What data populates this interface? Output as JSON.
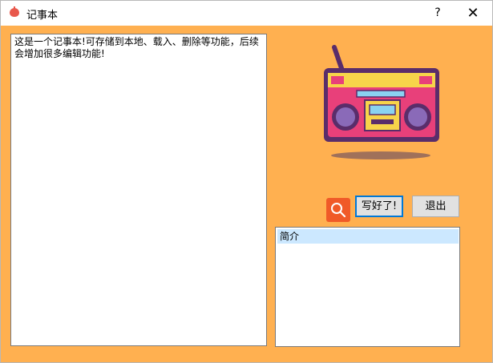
{
  "window": {
    "title": "记事本",
    "help_label": "?",
    "close_label": "✕",
    "background": "#ffb050"
  },
  "editor": {
    "text": "这是一个记事本!可存储到本地、载入、删除等功能，后续会增加很多编辑功能!"
  },
  "buttons": {
    "search_icon": "search-icon",
    "done_label": "写好了!",
    "exit_label": "退出"
  },
  "list": {
    "items": [
      "简介"
    ]
  },
  "colors": {
    "accent": "#0078d7",
    "search_button": "#f05a28",
    "selection": "#cce8ff"
  }
}
